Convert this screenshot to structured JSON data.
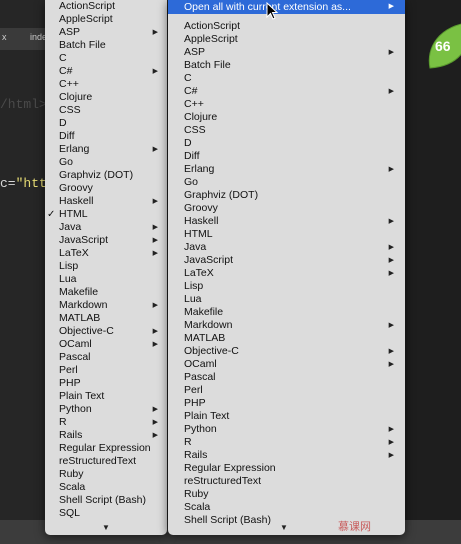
{
  "editor": {
    "tabs": [
      "x",
      "inde"
    ],
    "code_line_1": "/html>",
    "code_line_2_prefix": "c=",
    "code_line_2_str": "\"htt"
  },
  "menu1": {
    "items": [
      {
        "label": "ActionScript",
        "arrow": false,
        "checked": false
      },
      {
        "label": "AppleScript",
        "arrow": false,
        "checked": false
      },
      {
        "label": "ASP",
        "arrow": true,
        "checked": false
      },
      {
        "label": "Batch File",
        "arrow": false,
        "checked": false
      },
      {
        "label": "C",
        "arrow": false,
        "checked": false
      },
      {
        "label": "C#",
        "arrow": true,
        "checked": false
      },
      {
        "label": "C++",
        "arrow": false,
        "checked": false
      },
      {
        "label": "Clojure",
        "arrow": false,
        "checked": false
      },
      {
        "label": "CSS",
        "arrow": false,
        "checked": false
      },
      {
        "label": "D",
        "arrow": false,
        "checked": false
      },
      {
        "label": "Diff",
        "arrow": false,
        "checked": false
      },
      {
        "label": "Erlang",
        "arrow": true,
        "checked": false
      },
      {
        "label": "Go",
        "arrow": false,
        "checked": false
      },
      {
        "label": "Graphviz (DOT)",
        "arrow": false,
        "checked": false
      },
      {
        "label": "Groovy",
        "arrow": false,
        "checked": false
      },
      {
        "label": "Haskell",
        "arrow": true,
        "checked": false
      },
      {
        "label": "HTML",
        "arrow": false,
        "checked": true
      },
      {
        "label": "Java",
        "arrow": true,
        "checked": false
      },
      {
        "label": "JavaScript",
        "arrow": true,
        "checked": false
      },
      {
        "label": "LaTeX",
        "arrow": true,
        "checked": false
      },
      {
        "label": "Lisp",
        "arrow": false,
        "checked": false
      },
      {
        "label": "Lua",
        "arrow": false,
        "checked": false
      },
      {
        "label": "Makefile",
        "arrow": false,
        "checked": false
      },
      {
        "label": "Markdown",
        "arrow": true,
        "checked": false
      },
      {
        "label": "MATLAB",
        "arrow": false,
        "checked": false
      },
      {
        "label": "Objective-C",
        "arrow": true,
        "checked": false
      },
      {
        "label": "OCaml",
        "arrow": true,
        "checked": false
      },
      {
        "label": "Pascal",
        "arrow": false,
        "checked": false
      },
      {
        "label": "Perl",
        "arrow": false,
        "checked": false
      },
      {
        "label": "PHP",
        "arrow": false,
        "checked": false
      },
      {
        "label": "Plain Text",
        "arrow": false,
        "checked": false
      },
      {
        "label": "Python",
        "arrow": true,
        "checked": false
      },
      {
        "label": "R",
        "arrow": true,
        "checked": false
      },
      {
        "label": "Rails",
        "arrow": true,
        "checked": false
      },
      {
        "label": "Regular Expression",
        "arrow": false,
        "checked": false
      },
      {
        "label": "reStructuredText",
        "arrow": false,
        "checked": false
      },
      {
        "label": "Ruby",
        "arrow": false,
        "checked": false
      },
      {
        "label": "Scala",
        "arrow": false,
        "checked": false
      },
      {
        "label": "Shell Script (Bash)",
        "arrow": false,
        "checked": false
      },
      {
        "label": "SQL",
        "arrow": false,
        "checked": false
      }
    ],
    "check_glyph": "✓",
    "arrow_glyph": "▶",
    "scroll_glyph": "▼"
  },
  "menu2": {
    "header": "Open all with current extension as...",
    "items": [
      {
        "label": "ActionScript",
        "arrow": false
      },
      {
        "label": "AppleScript",
        "arrow": false
      },
      {
        "label": "ASP",
        "arrow": true
      },
      {
        "label": "Batch File",
        "arrow": false
      },
      {
        "label": "C",
        "arrow": false
      },
      {
        "label": "C#",
        "arrow": true
      },
      {
        "label": "C++",
        "arrow": false
      },
      {
        "label": "Clojure",
        "arrow": false
      },
      {
        "label": "CSS",
        "arrow": false
      },
      {
        "label": "D",
        "arrow": false
      },
      {
        "label": "Diff",
        "arrow": false
      },
      {
        "label": "Erlang",
        "arrow": true
      },
      {
        "label": "Go",
        "arrow": false
      },
      {
        "label": "Graphviz (DOT)",
        "arrow": false
      },
      {
        "label": "Groovy",
        "arrow": false
      },
      {
        "label": "Haskell",
        "arrow": true
      },
      {
        "label": "HTML",
        "arrow": false
      },
      {
        "label": "Java",
        "arrow": true
      },
      {
        "label": "JavaScript",
        "arrow": true
      },
      {
        "label": "LaTeX",
        "arrow": true
      },
      {
        "label": "Lisp",
        "arrow": false
      },
      {
        "label": "Lua",
        "arrow": false
      },
      {
        "label": "Makefile",
        "arrow": false
      },
      {
        "label": "Markdown",
        "arrow": true
      },
      {
        "label": "MATLAB",
        "arrow": false
      },
      {
        "label": "Objective-C",
        "arrow": true
      },
      {
        "label": "OCaml",
        "arrow": true
      },
      {
        "label": "Pascal",
        "arrow": false
      },
      {
        "label": "Perl",
        "arrow": false
      },
      {
        "label": "PHP",
        "arrow": false
      },
      {
        "label": "Plain Text",
        "arrow": false
      },
      {
        "label": "Python",
        "arrow": true
      },
      {
        "label": "R",
        "arrow": true
      },
      {
        "label": "Rails",
        "arrow": true
      },
      {
        "label": "Regular Expression",
        "arrow": false
      },
      {
        "label": "reStructuredText",
        "arrow": false
      },
      {
        "label": "Ruby",
        "arrow": false
      },
      {
        "label": "Scala",
        "arrow": false
      },
      {
        "label": "Shell Script (Bash)",
        "arrow": false
      }
    ]
  },
  "badge": {
    "text": "66"
  },
  "watermark": {
    "text": "慕课网"
  },
  "colors": {
    "highlight": "#2d6ad8",
    "menu_bg": "#dcdcdc",
    "leaf": "#7ac143"
  }
}
